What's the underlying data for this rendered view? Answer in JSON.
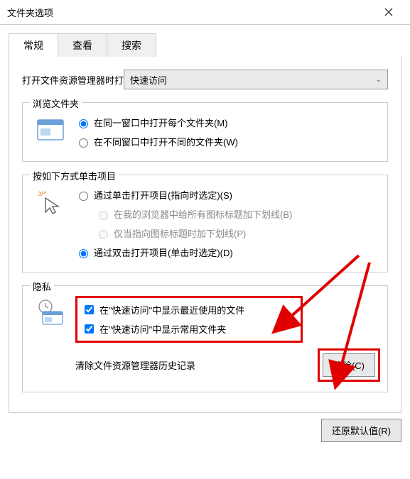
{
  "window": {
    "title": "文件夹选项"
  },
  "tabs": {
    "general": "常规",
    "view": "查看",
    "search": "搜索"
  },
  "openIn": {
    "label": "打开文件资源管理器时打",
    "selected": "快速访问"
  },
  "browseFolders": {
    "legend": "浏览文件夹",
    "opt1": "在同一窗口中打开每个文件夹(M)",
    "opt2": "在不同窗口中打开不同的文件夹(W)"
  },
  "clickItems": {
    "legend": "按如下方式单击项目",
    "opt1": "通过单击打开项目(指向时选定)(S)",
    "sub1": "在我的浏览器中给所有图标标题加下划线(B)",
    "sub2": "仅当指向图标标题时加下划线(P)",
    "opt2": "通过双击打开项目(单击时选定)(D)"
  },
  "privacy": {
    "legend": "隐私",
    "chk1": "在\"快速访问\"中显示最近使用的文件",
    "chk2": "在\"快速访问\"中显示常用文件夹",
    "clearLabel": "清除文件资源管理器历史记录",
    "clearBtn": "清除(C)"
  },
  "footer": {
    "restore": "还原默认值(R)"
  }
}
